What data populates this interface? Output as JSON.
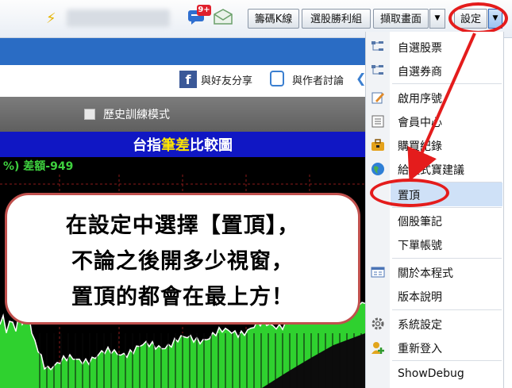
{
  "toolbar": {
    "badge": "9+",
    "buttons": [
      "籌碼K線",
      "選股勝利組",
      "擷取畫面"
    ],
    "settings_label": "設定",
    "dropdown_glyph": "▼"
  },
  "share": {
    "facebook_glyph": "f",
    "share_label": "與好友分享",
    "discuss_label": "與作者討論"
  },
  "history": {
    "label": "歷史訓練模式"
  },
  "chart_title": {
    "part1": "台指",
    "part2": "筆差",
    "part3": "比較圖"
  },
  "diff_label": "%) 差額-949",
  "callout": {
    "line1": "在設定中選擇【置頂】，",
    "line2": "不論之後開多少視窗，",
    "line3": "置頂的都會在最上方！"
  },
  "menu": {
    "items": [
      {
        "label": "自選股票",
        "icon": "tree-icon"
      },
      {
        "label": "自選券商",
        "icon": "tree-icon"
      },
      {
        "label": "啟用序號",
        "icon": "edit-icon"
      },
      {
        "label": "會員中心",
        "icon": "document-icon"
      },
      {
        "label": "購買紀錄",
        "icon": "briefcase-icon"
      },
      {
        "label": "給程式寶建議",
        "icon": "globe-icon"
      },
      {
        "label": "置頂",
        "icon": ""
      },
      {
        "label": "個股筆記",
        "icon": ""
      },
      {
        "label": "下單帳號",
        "icon": ""
      },
      {
        "label": "關於本程式",
        "icon": "window-icon"
      },
      {
        "label": "版本說明",
        "icon": ""
      },
      {
        "label": "系統設定",
        "icon": "gear-icon"
      },
      {
        "label": "重新登入",
        "icon": "user-add-icon"
      },
      {
        "label": "ShowDebug",
        "icon": ""
      }
    ]
  },
  "colors": {
    "highlight_red": "#e41c1c",
    "title_bg": "#1017c4",
    "title_highlight": "#ffe600",
    "chart_green": "#2fd12f",
    "menu_selected": "#cfe1f7"
  }
}
